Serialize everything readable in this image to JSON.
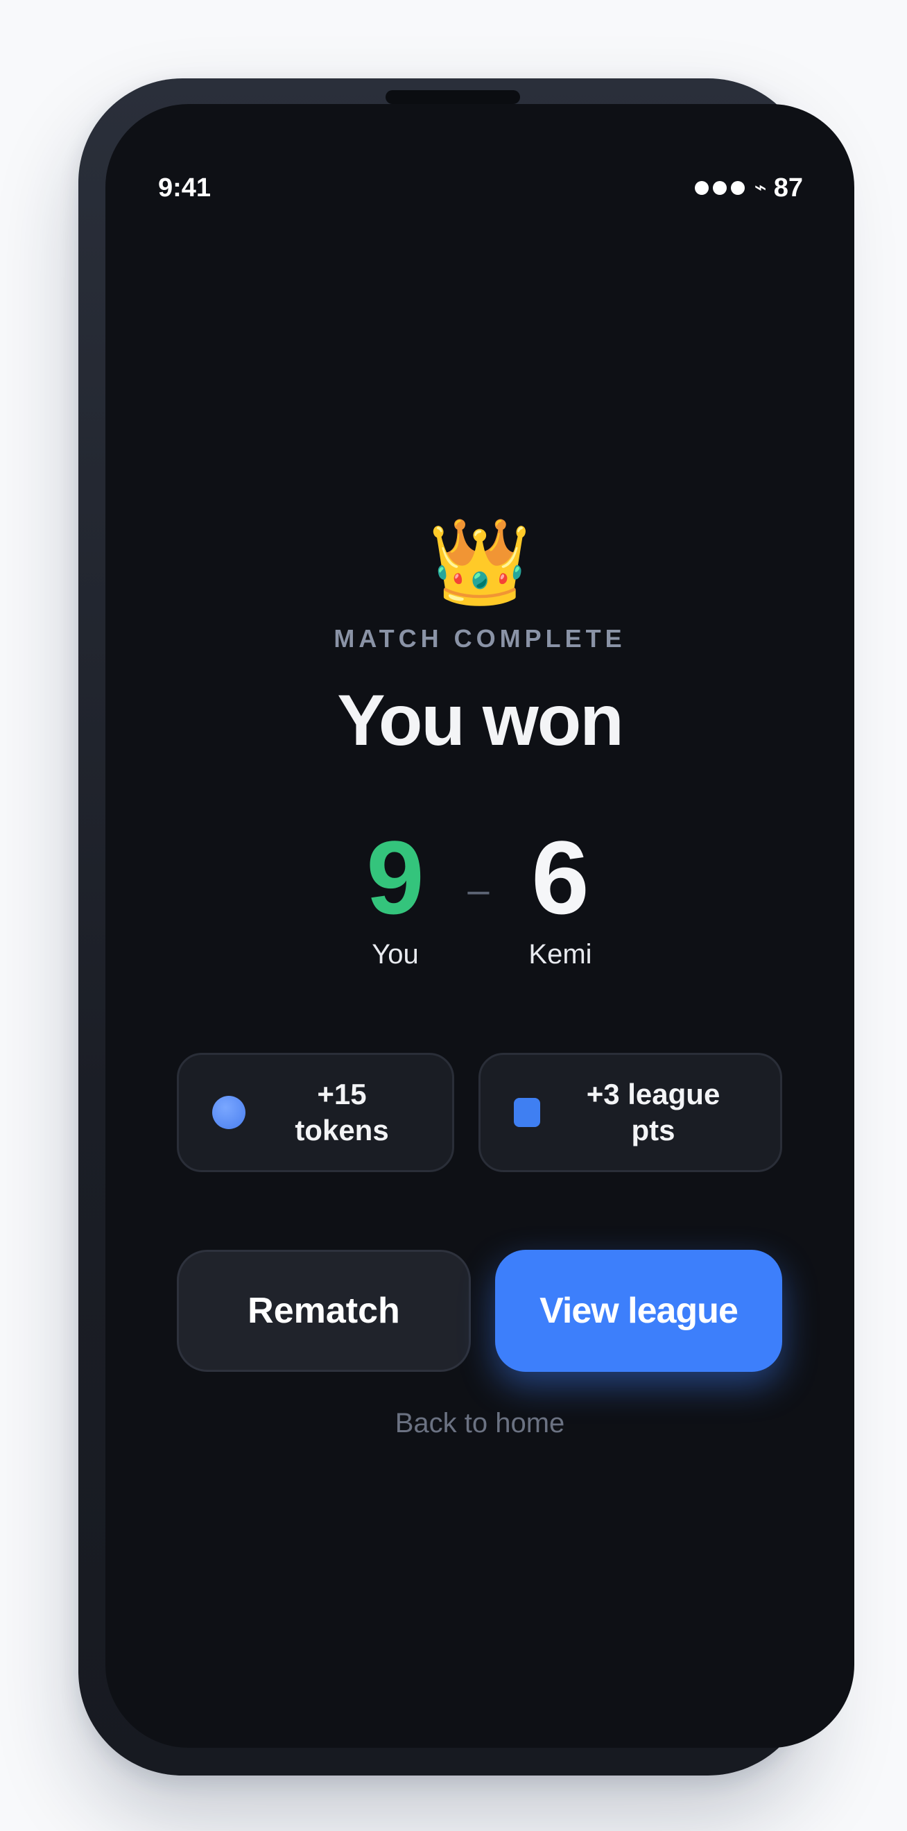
{
  "status_bar": {
    "time": "9:41",
    "battery": "87",
    "icons": [
      "signal-dots-icon",
      "bolt-icon"
    ]
  },
  "result": {
    "icon": "crown-icon",
    "crown_glyph": "👑",
    "eyebrow": "MATCH COMPLETE",
    "title": "You won"
  },
  "score": {
    "player_score": "9",
    "player_name": "You",
    "separator": "–",
    "opponent_score": "6",
    "opponent_name": "Kemi"
  },
  "rewards": [
    {
      "icon": "token-coin-icon",
      "line1": "+15",
      "line2": "tokens"
    },
    {
      "icon": "league-badge-icon",
      "line1": "+3 league",
      "line2": "pts"
    }
  ],
  "actions": {
    "rematch_label": "Rematch",
    "view_league_label": "View league",
    "back_home_label": "Back to home"
  },
  "colors": {
    "background": "#0e1015",
    "win_score": "#34c47c",
    "accent": "#3d7ffb",
    "muted": "#8a93a6"
  }
}
